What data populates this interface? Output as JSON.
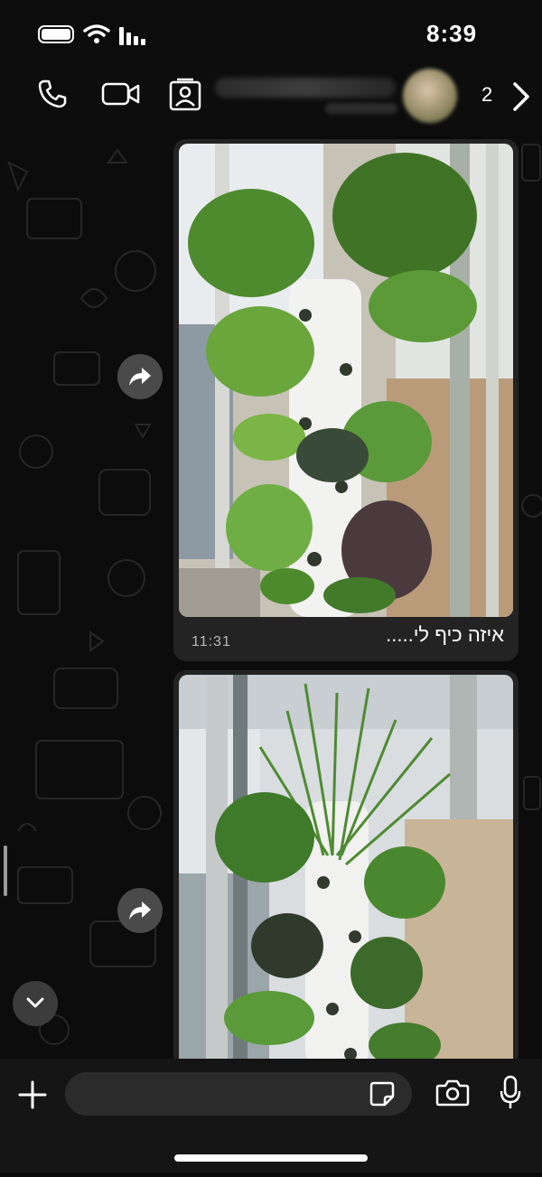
{
  "status_bar": {
    "time": "8:39"
  },
  "header": {
    "contact_name": "",
    "contact_status": "",
    "unread_count": "2"
  },
  "messages": [
    {
      "caption": "איזה כיף לי.....",
      "time": "11:31"
    },
    {
      "caption": "",
      "time": ""
    }
  ],
  "composer": {
    "value": "",
    "placeholder": ""
  },
  "icons": {
    "call": "phone-icon",
    "video": "video-camera-icon",
    "contact": "contact-card-icon",
    "back": "chevron-right-icon",
    "forward": "forward-arrow-icon",
    "scroll": "chevron-down-icon",
    "attach": "plus-icon",
    "sticker": "sticker-icon",
    "camera": "camera-icon",
    "mic": "microphone-icon"
  },
  "colors": {
    "background": "#0b0b0b",
    "bubble": "#232323",
    "text": "#ffffff"
  }
}
